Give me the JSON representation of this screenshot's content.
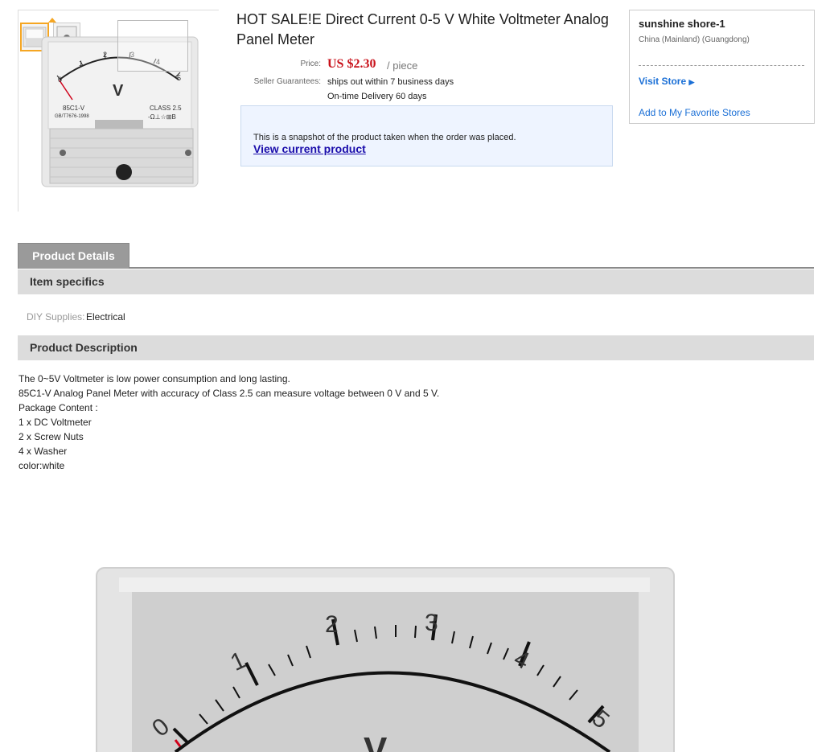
{
  "product": {
    "title": "HOT SALE!E Direct Current 0-5 V White Voltmeter Analog Panel Meter",
    "price_label": "Price:",
    "price_value": "US $2.30",
    "price_unit": "/ piece",
    "guarantee_label": "Seller Guarantees:",
    "guarantee_line1": "ships out within 7 business days",
    "guarantee_line2": "On-time Delivery 60 days",
    "snapshot_text": "This is a snapshot of the product taken when the order was placed.",
    "snapshot_link": "View current product"
  },
  "gallery": {
    "meter_model": "85C1-V",
    "meter_standard": "GB/T7676-1998",
    "meter_class": "CLASS 2.5",
    "meter_symbols": "-Ω⊥☆⊞B",
    "meter_unit": "V",
    "scale_labels": [
      "0",
      "1",
      "2",
      "3",
      "4",
      "5"
    ]
  },
  "store": {
    "name": "sunshine shore-1",
    "location": "China (Mainland) (Guangdong)",
    "visit_label": "Visit Store",
    "favorite_label": "Add to My Favorite Stores"
  },
  "tabs": {
    "product_details": "Product Details"
  },
  "sections": {
    "item_specifics": "Item specifics",
    "product_description": "Product Description"
  },
  "specifics": [
    {
      "label": "DIY Supplies:",
      "value": "Electrical"
    }
  ],
  "description": [
    "The 0~5V Voltmeter is low power consumption and long lasting.",
    "85C1-V Analog Panel Meter with accuracy of Class 2.5 can measure voltage between 0 V and 5 V.",
    "Package Content :",
    "1 x DC Voltmeter",
    "2 x Screw Nuts",
    "4 x Washer",
    "color:white"
  ],
  "big_image": {
    "scale_labels": [
      "0",
      "1",
      "2",
      "3",
      "4",
      "5"
    ],
    "unit": "V"
  },
  "colors": {
    "price": "#c9121b",
    "link": "#1a6fd6",
    "snapshot_bg": "#eef4ff",
    "tab_bg": "#9a9a9a",
    "section_bg": "#dcdcdc",
    "accent_thumb": "#f5a623"
  }
}
